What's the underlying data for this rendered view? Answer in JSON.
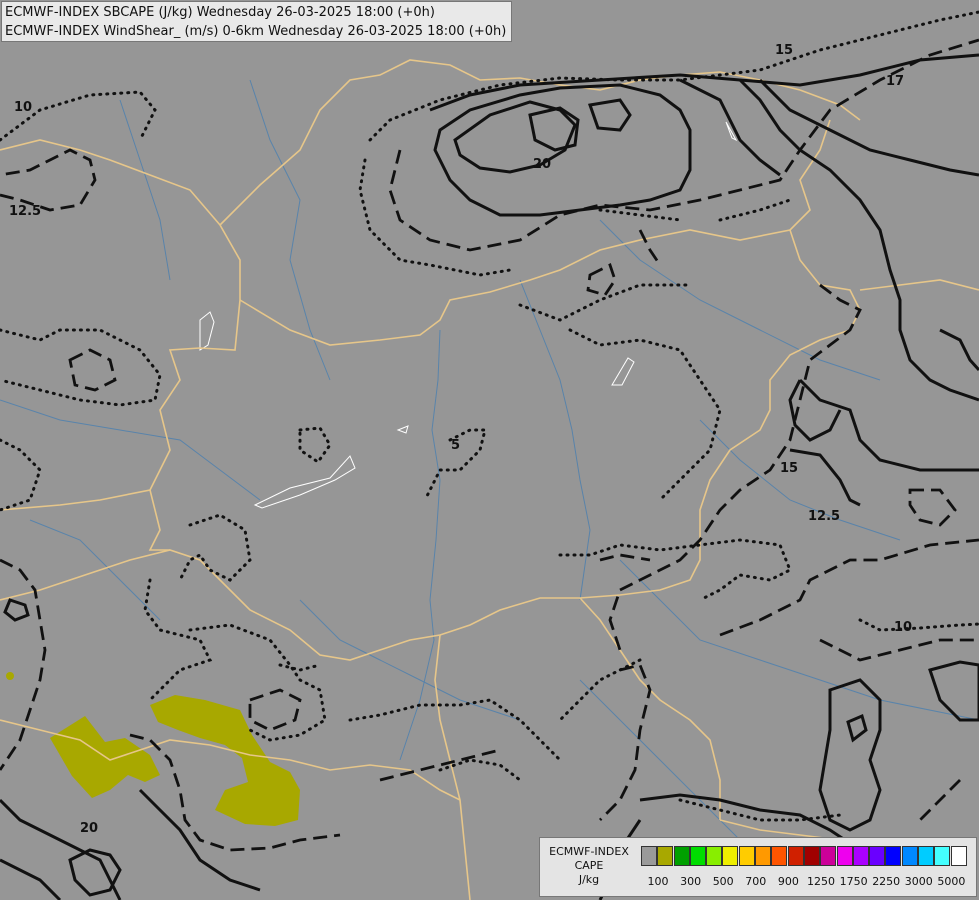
{
  "titles": {
    "line1": "ECMWF-INDEX SBCAPE (J/kg) Wednesday 26-03-2025 18:00 (+0h)",
    "line2": "ECMWF-INDEX WindShear_ (m/s) 0-6km Wednesday 26-03-2025 18:00 (+0h)"
  },
  "legend": {
    "model": "ECMWF-INDEX",
    "field": "CAPE",
    "unit": "J/kg",
    "colors": [
      "#9a9a9a",
      "#a8a800",
      "#00a000",
      "#00dd00",
      "#88ee00",
      "#eeee00",
      "#ffcc00",
      "#ff9900",
      "#ff5500",
      "#d02000",
      "#a00000",
      "#cc0099",
      "#ee00ee",
      "#aa00ff",
      "#6a00ff",
      "#0000ff",
      "#0088ff",
      "#00ccff",
      "#44ffff",
      "#ffffff"
    ],
    "ticks": [
      "100",
      "300",
      "500",
      "700",
      "900",
      "1250",
      "1750",
      "2250",
      "3000",
      "5000"
    ]
  },
  "contour_labels": [
    "10",
    "12.5",
    "15",
    "17",
    "20",
    "5",
    "10",
    "12.5",
    "15",
    "20"
  ]
}
